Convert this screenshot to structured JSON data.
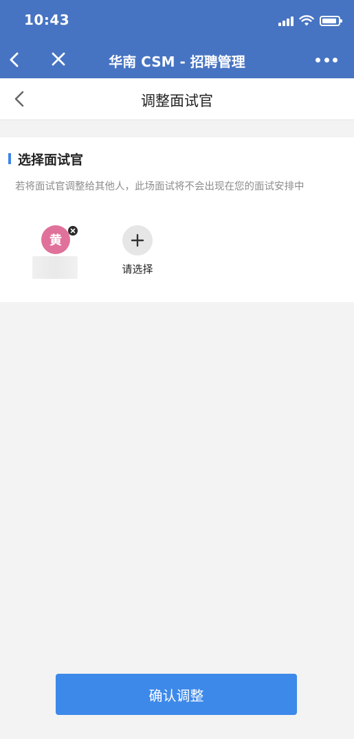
{
  "status_bar": {
    "time": "10:43"
  },
  "nav": {
    "title": "华南 CSM - 招聘管理"
  },
  "page": {
    "title": "调整面试官"
  },
  "section": {
    "title": "选择面试官",
    "hint": "若将面试官调整给其他人，此场面试将不会出现在您的面试安排中"
  },
  "interviewer": {
    "avatar_char": "黄"
  },
  "add": {
    "label": "请选择"
  },
  "confirm_label": "确认调整",
  "colors": {
    "nav_bg": "#4774c2",
    "accent": "#3d89ea",
    "avatar_bg": "#e0719a",
    "page_bg": "#f3f3f3"
  },
  "icons": {
    "back": "chevron-left-icon",
    "close": "close-icon",
    "more": "more-icon",
    "remove": "remove-icon",
    "add": "plus-icon"
  }
}
